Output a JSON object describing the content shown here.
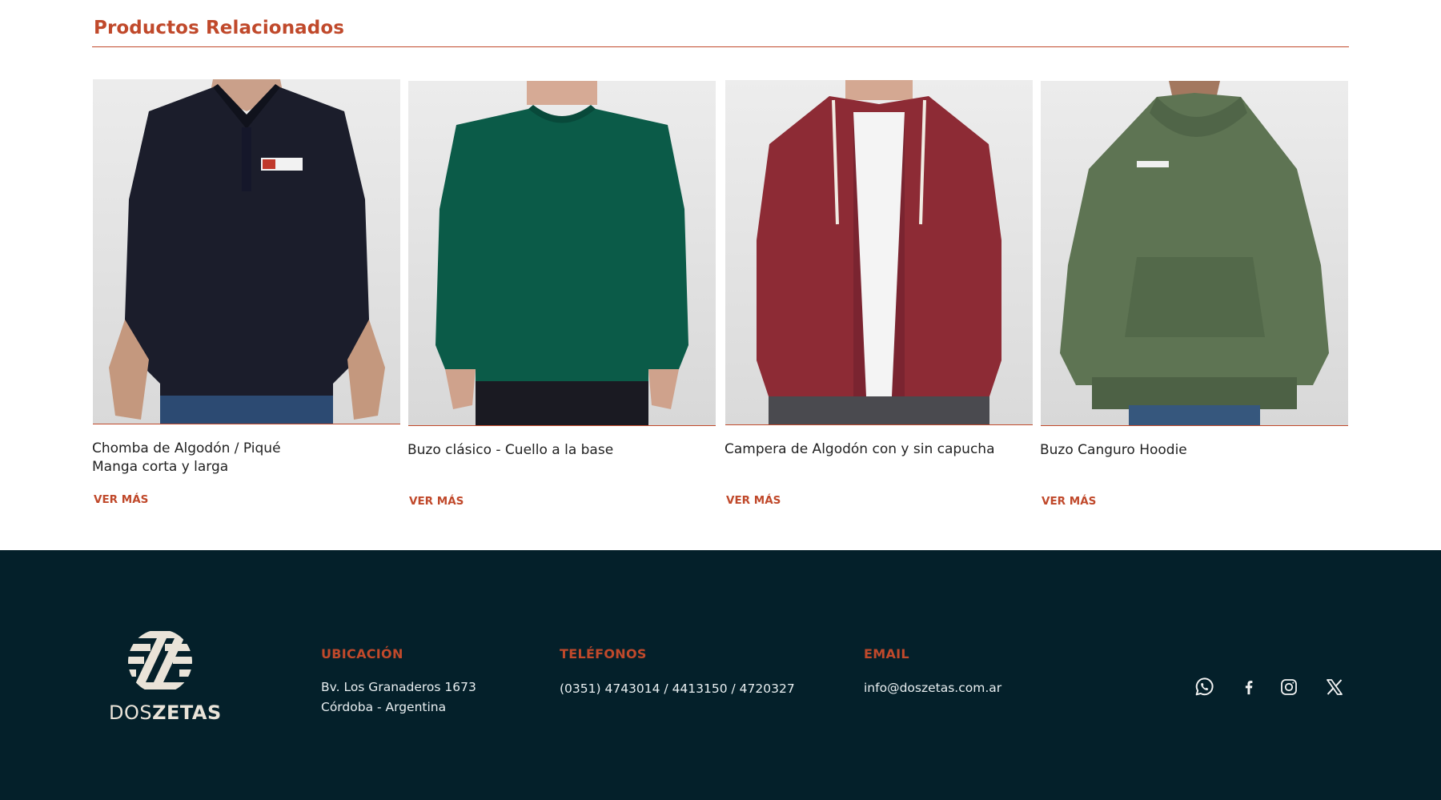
{
  "colors": {
    "accent": "#c0492b",
    "footer_bg": "#04202a",
    "footer_text": "#e8eef0",
    "logo_cream": "#e9e3d8"
  },
  "related": {
    "title": "Productos Relacionados",
    "products": [
      {
        "name_lines": [
          "Chomba de Algodón / Piqué",
          "Manga corta y larga"
        ],
        "link_label": "VER MÁS",
        "image": "navy-polo-shirt-photo"
      },
      {
        "name_lines": [
          "Buzo clásico - Cuello a la base"
        ],
        "link_label": "VER MÁS",
        "image": "green-crewneck-sweatshirt-photo"
      },
      {
        "name_lines": [
          "Campera de Algodón con y sin capucha"
        ],
        "link_label": "VER MÁS",
        "image": "burgundy-zip-hoodie-photo"
      },
      {
        "name_lines": [
          "Buzo Canguro Hoodie"
        ],
        "link_label": "VER MÁS",
        "image": "olive-pullover-hoodie-photo"
      }
    ]
  },
  "footer": {
    "logo": {
      "icon": "doszetas-logo-icon",
      "brand_light": "DOS",
      "brand_bold": "ZETAS"
    },
    "location": {
      "heading": "UBICACIÓN",
      "lines": [
        "Bv. Los Granaderos 1673",
        "Córdoba  -  Argentina"
      ]
    },
    "phones": {
      "heading": "TELÉFONOS",
      "lines": [
        "(0351) 4743014 / 4413150 / 4720327"
      ]
    },
    "email": {
      "heading": "EMAIL",
      "lines": [
        "info@doszetas.com.ar"
      ]
    },
    "socials": [
      {
        "name": "whatsapp-icon"
      },
      {
        "name": "facebook-icon"
      },
      {
        "name": "instagram-icon"
      },
      {
        "name": "x-twitter-icon"
      }
    ]
  }
}
